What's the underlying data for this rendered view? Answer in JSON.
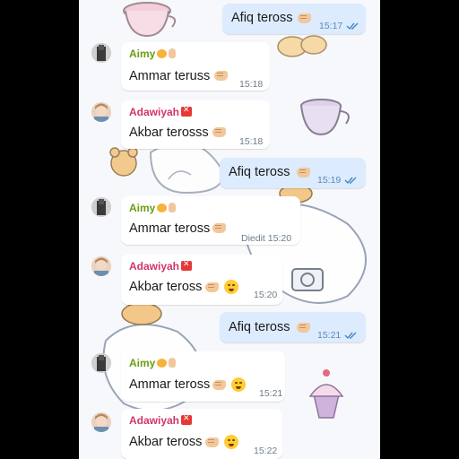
{
  "theme": {
    "outgoing_bubble": "#dcebfd",
    "incoming_bubble": "#ffffff",
    "aimy_name_color": "#6c9d17",
    "adawiyah_name_color": "#d1356b",
    "tick_color": "#4a86c8"
  },
  "messages": [
    {
      "direction": "out",
      "text": "Afiq teross",
      "time": "15:17",
      "status_icon": "double-check-icon"
    },
    {
      "direction": "in",
      "sender": "Aimy",
      "text": "Ammar teruss",
      "time": "15:18"
    },
    {
      "direction": "in",
      "sender": "Adawiyah",
      "text": "Akbar terosss",
      "time": "15:18"
    },
    {
      "direction": "out",
      "text": "Afiq teross",
      "time": "15:19",
      "status_icon": "double-check-icon"
    },
    {
      "direction": "in",
      "sender": "Aimy",
      "text": "Ammar teross",
      "time": "Diedit 15:20"
    },
    {
      "direction": "in",
      "sender": "Adawiyah",
      "text": "Akbar teross",
      "time": "15:20"
    },
    {
      "direction": "out",
      "text": "Afiq teross",
      "time": "15:21",
      "status_icon": "double-check-icon"
    },
    {
      "direction": "in",
      "sender": "Aimy",
      "text": "Ammar teross",
      "time": "15:21"
    },
    {
      "direction": "in",
      "sender": "Adawiyah",
      "text": "Akbar teross",
      "time": "15:22"
    }
  ]
}
